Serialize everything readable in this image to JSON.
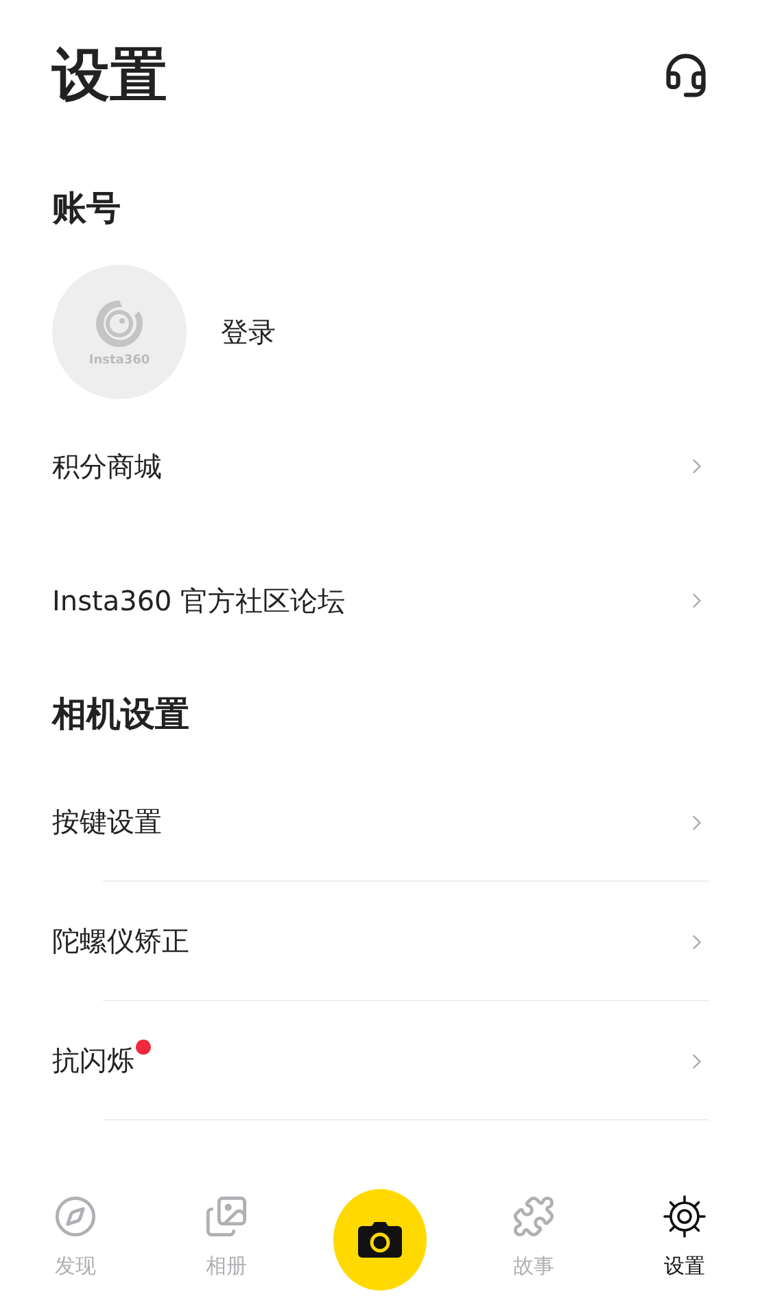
{
  "title": "设置",
  "sections": [
    {
      "header": "账号",
      "account": {
        "logo_text": "Insta360",
        "login": "登录"
      },
      "rows": [
        {
          "label": "积分商城",
          "divider": false,
          "dot": false
        },
        {
          "label": "Insta360 官方社区论坛",
          "divider": false,
          "dot": false
        }
      ]
    },
    {
      "header": "相机设置",
      "rows": [
        {
          "label": "按键设置",
          "divider": true,
          "dot": false
        },
        {
          "label": "陀螺仪矫正",
          "divider": true,
          "dot": false
        },
        {
          "label": "抗闪烁",
          "divider": true,
          "dot": true
        }
      ]
    }
  ],
  "nav": [
    {
      "kind": "tab",
      "label": "发现",
      "selected": false
    },
    {
      "kind": "tab",
      "label": "相册",
      "selected": false
    },
    {
      "kind": "camera"
    },
    {
      "kind": "tab",
      "label": "故事",
      "selected": false
    },
    {
      "kind": "tab",
      "label": "设置",
      "selected": true
    }
  ]
}
